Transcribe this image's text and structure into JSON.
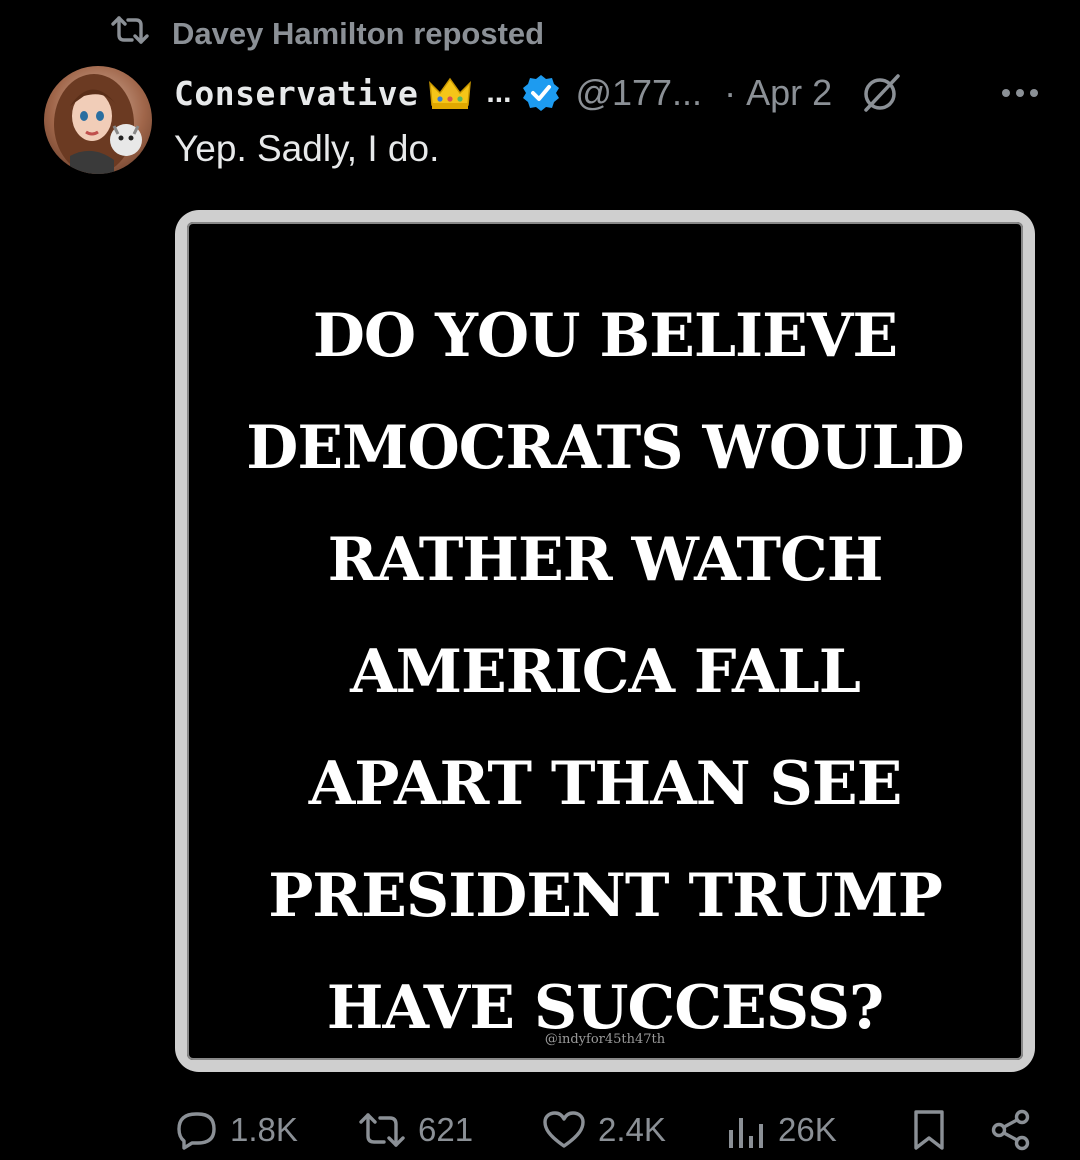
{
  "repost": {
    "text": "Davey Hamilton reposted"
  },
  "post": {
    "display_name": "Conservative",
    "name_truncation": "...",
    "handle": "@177...",
    "separator": "·",
    "date": "Apr 2",
    "text": "Yep. Sadly, I do.",
    "image": {
      "lines": [
        "DO YOU BELIEVE",
        "DEMOCRATS WOULD",
        "RATHER WATCH",
        "AMERICA FALL",
        "APART THAN SEE",
        "PRESIDENT TRUMP",
        "HAVE SUCCESS?"
      ],
      "watermark": "@indyfor45th47th"
    }
  },
  "actions": {
    "replies": "1.8K",
    "reposts": "621",
    "likes": "2.4K",
    "views": "26K"
  },
  "colors": {
    "background": "#000000",
    "text_primary": "#e7e9ea",
    "text_secondary": "#8b9096",
    "verified_badge": "#1d9bf0"
  },
  "icons": {
    "repost": "repost-icon",
    "crown": "crown-icon",
    "verified": "verified-badge-icon",
    "grok": "grok-icon",
    "more": "more-icon",
    "reply": "reply-icon",
    "like": "heart-icon",
    "views": "views-icon",
    "bookmark": "bookmark-icon",
    "share": "share-icon"
  }
}
